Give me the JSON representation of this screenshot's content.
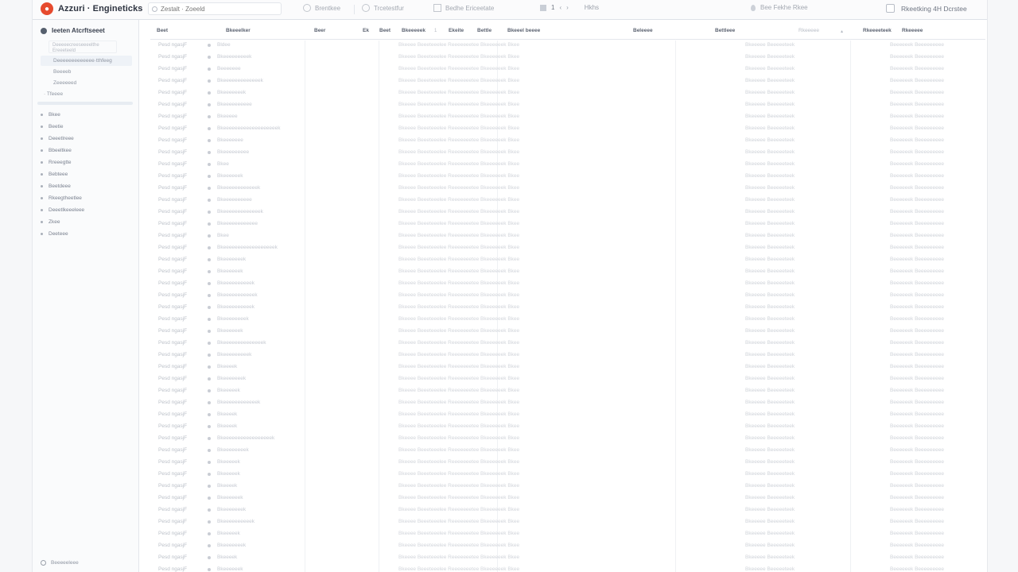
{
  "app": {
    "title": "Azzuri · Engineticks"
  },
  "toolbar": {
    "search_placeholder": "Zestalt · Zoeeld",
    "item1": "Brentkee",
    "item2": "Trcetestfur",
    "item3": "Bedhe Ericeetate",
    "pager_current": "1",
    "pager_prev": "‹",
    "pager_next": "›",
    "pager_label": "Hkhs",
    "location": "Bee Fekhe Rkee",
    "checkbox_label": "Rkeetking 4H Dcrstee",
    "checkbox_checked": false
  },
  "sidebar": {
    "header": "Ieeten Atcrftseeet",
    "card_text": "Deeeeecreeseeeelthe Ereeeteeld",
    "selected_item": "Deeeeeeeeeeeee·tthfeeg",
    "sub_items": [
      "Beeeeb",
      "Zeeeeeed"
    ],
    "dim_item": "Tfeeee",
    "items": [
      "Bkee",
      "Beetie",
      "Deeetlreee",
      "Bbeeltkee",
      "Rreeegtte",
      "Bebteee",
      "Beetdeee",
      "Rkeegtheetlee",
      "Deeetlkeeeleee",
      "Zkee",
      "Deeteee"
    ],
    "footer": "Beeeeeleee"
  },
  "table": {
    "columns": [
      "Beet",
      "Bkeeelker",
      "Beer",
      "Ek",
      "Beet",
      "Bkeeeeek",
      "1",
      "Ekeite",
      "Bettle",
      "Bkeeel beeee",
      "Beleeee",
      "Bettleee",
      "Rkeeeee",
      "▴",
      "Rkeeeeteek",
      "Rkeeeee"
    ],
    "rows": [
      {
        "name": "Pesd ngasjF",
        "cat": "Bldee",
        "long": "Bkeeee  Beeeteeelee  Reeeeeeetee  Bkeeeeeek  Bkee",
        "right": "Bkeeeee  Beeeeeteek",
        "end": "Beeeeeek  Beeeeeeeee"
      },
      {
        "name": "Pesd ngasjF",
        "cat": "Bkeeeeeeeeek",
        "long": "Bkeeee  Beeeteeelee  Reeeeeeetee  Bkeeeeeek  Bkee",
        "right": "Bkeeeee  Beeeeeteek",
        "end": "Beeeeeek  Beeeeeeeee"
      },
      {
        "name": "Pesd ngasjF",
        "cat": "Beeeeeee",
        "long": "Bkeeee  Beeeteeelee  Reeeeeeetee  Bkeeeeeek  Bkee",
        "right": "Bkeeeee  Beeeeeteek",
        "end": "Beeeeeek  Beeeeeeeee"
      },
      {
        "name": "Pesd ngasjF",
        "cat": "Bkeeeeeeeeeeeeek",
        "long": "Bkeeee  Beeeteeelee  Reeeeeeetee  Bkeeeeeek  Bkee",
        "right": "Bkeeeee  Beeeeeteek",
        "end": "Beeeeeek  Beeeeeeeee"
      },
      {
        "name": "Pesd ngasjF",
        "cat": "Bkeeeeeeek",
        "long": "Bkeeee  Beeeteeelee  Reeeeeeetee  Bkeeeeeek  Bkee",
        "right": "Bkeeeee  Beeeeeteek",
        "end": "Beeeeeek  Beeeeeeeee"
      },
      {
        "name": "Pesd ngasjF",
        "cat": "Bkeeeeeeeeee",
        "long": "Bkeeee  Beeeteeelee  Reeeeeeetee  Bkeeeeeek  Bkee",
        "right": "Bkeeeee  Beeeeeteek",
        "end": "Beeeeeek  Beeeeeeeee"
      },
      {
        "name": "Pesd ngasjF",
        "cat": "Bkeeeee",
        "long": "Bkeeee  Beeeteeelee  Reeeeeeetee  Bkeeeeeek  Bkee",
        "right": "Bkeeeee  Beeeeeteek",
        "end": "Beeeeeek  Beeeeeeeee"
      },
      {
        "name": "Pesd ngasjF",
        "cat": "Bkeeeeeeeeeeeeeeeeeeek",
        "long": "Bkeeee  Beeeteeelee  Reeeeeeetee  Bkeeeeeek  Bkee",
        "right": "Bkeeeee  Beeeeeteek",
        "end": "Beeeeeek  Beeeeeeeee"
      },
      {
        "name": "Pesd ngasjF",
        "cat": "Bkeeeeeee",
        "long": "Bkeeee  Beeeteeelee  Reeeeeeetee  Bkeeeeeek  Bkee",
        "right": "Bkeeeee  Beeeeeteek",
        "end": "Beeeeeek  Beeeeeeeee"
      },
      {
        "name": "Pesd ngasjF",
        "cat": "Bkeeeeeeeee",
        "long": "Bkeeee  Beeeteeelee  Reeeeeeetee  Bkeeeeeek  Bkee",
        "right": "Bkeeeee  Beeeeeteek",
        "end": "Beeeeeek  Beeeeeeeee"
      },
      {
        "name": "Pesd ngasjF",
        "cat": "Bkee",
        "long": "Bkeeee  Beeeteeelee  Reeeeeeetee  Bkeeeeeek  Bkee",
        "right": "Bkeeeee  Beeeeeteek",
        "end": "Beeeeeek  Beeeeeeeee"
      },
      {
        "name": "Pesd ngasjF",
        "cat": "Bkeeeeeek",
        "long": "Bkeeee  Beeeteeelee  Reeeeeeetee  Bkeeeeeek  Bkee",
        "right": "Bkeeeee  Beeeeeteek",
        "end": "Beeeeeek  Beeeeeeeee"
      },
      {
        "name": "Pesd ngasjF",
        "cat": "Bkeeeeeeeeeeeek",
        "long": "Bkeeee  Beeeteeelee  Reeeeeeetee  Bkeeeeeek  Bkee",
        "right": "Bkeeeee  Beeeeeteek",
        "end": "Beeeeeek  Beeeeeeeee"
      },
      {
        "name": "Pesd ngasjF",
        "cat": "Bkeeeeeeeeee",
        "long": "Bkeeee  Beeeteeelee  Reeeeeeetee  Bkeeeeeek  Bkee",
        "right": "Bkeeeee  Beeeeeteek",
        "end": "Beeeeeek  Beeeeeeeee"
      },
      {
        "name": "Pesd ngasjF",
        "cat": "Bkeeeeeeeeeeeeek",
        "long": "Bkeeee  Beeeteeelee  Reeeeeeetee  Bkeeeeeek  Bkee",
        "right": "Bkeeeee  Beeeeeteek",
        "end": "Beeeeeek  Beeeeeeeee"
      },
      {
        "name": "Pesd ngasjF",
        "cat": "Bkeeeeeeeeeeee",
        "long": "Bkeeee  Beeeteeelee  Reeeeeeetee  Bkeeeeeek  Bkee",
        "right": "Bkeeeee  Beeeeeteek",
        "end": "Beeeeeek  Beeeeeeeee"
      },
      {
        "name": "Pesd ngasjF",
        "cat": "Bkee",
        "long": "Bkeeee  Beeeteeelee  Reeeeeeetee  Bkeeeeeek  Bkee",
        "right": "Bkeeeee  Beeeeeteek",
        "end": "Beeeeeek  Beeeeeeeee"
      },
      {
        "name": "Pesd ngasjF",
        "cat": "Bkeeeeeeeeeeeeeeeeeek",
        "long": "Bkeeee  Beeeteeelee  Reeeeeeetee  Bkeeeeeek  Bkee",
        "right": "Bkeeeee  Beeeeeteek",
        "end": "Beeeeeek  Beeeeeeeee"
      },
      {
        "name": "Pesd ngasjF",
        "cat": "Bkeeeeeeek",
        "long": "Bkeeee  Beeeteeelee  Reeeeeeetee  Bkeeeeeek  Bkee",
        "right": "Bkeeeee  Beeeeeteek",
        "end": "Beeeeeek  Beeeeeeeee"
      },
      {
        "name": "Pesd ngasjF",
        "cat": "Bkeeeeeek",
        "long": "Bkeeee  Beeeteeelee  Reeeeeeetee  Bkeeeeeek  Bkee",
        "right": "Bkeeeee  Beeeeeteek",
        "end": "Beeeeeek  Beeeeeeeee"
      },
      {
        "name": "Pesd ngasjF",
        "cat": "Bkeeeeeeeeeek",
        "long": "Bkeeee  Beeeteeelee  Reeeeeeetee  Bkeeeeeek  Bkee",
        "right": "Bkeeeee  Beeeeeteek",
        "end": "Beeeeeek  Beeeeeeeee"
      },
      {
        "name": "Pesd ngasjF",
        "cat": "Bkeeeeeeeeeeek",
        "long": "Bkeeee  Beeeteeelee  Reeeeeeetee  Bkeeeeeek  Bkee",
        "right": "Bkeeeee  Beeeeeteek",
        "end": "Beeeeeek  Beeeeeeeee"
      },
      {
        "name": "Pesd ngasjF",
        "cat": "Bkeeeeeeeeeek",
        "long": "Bkeeee  Beeeteeelee  Reeeeeeetee  Bkeeeeeek  Bkee",
        "right": "Bkeeeee  Beeeeeteek",
        "end": "Beeeeeek  Beeeeeeeee"
      },
      {
        "name": "Pesd ngasjF",
        "cat": "Bkeeeeeeeek",
        "long": "Bkeeee  Beeeteeelee  Reeeeeeetee  Bkeeeeeek  Bkee",
        "right": "Bkeeeee  Beeeeeteek",
        "end": "Beeeeeek  Beeeeeeeee"
      },
      {
        "name": "Pesd ngasjF",
        "cat": "Bkeeeeeek",
        "long": "Bkeeee  Beeeteeelee  Reeeeeeetee  Bkeeeeeek  Bkee",
        "right": "Bkeeeee  Beeeeeteek",
        "end": "Beeeeeek  Beeeeeeeee"
      },
      {
        "name": "Pesd ngasjF",
        "cat": "Bkeeeeeeeeeeeeeek",
        "long": "Bkeeee  Beeeteeelee  Reeeeeeetee  Bkeeeeeek  Bkee",
        "right": "Bkeeeee  Beeeeeteek",
        "end": "Beeeeeek  Beeeeeeeee"
      },
      {
        "name": "Pesd ngasjF",
        "cat": "Bkeeeeeeeeek",
        "long": "Bkeeee  Beeeteeelee  Reeeeeeetee  Bkeeeeeek  Bkee",
        "right": "Bkeeeee  Beeeeeteek",
        "end": "Beeeeeek  Beeeeeeeee"
      },
      {
        "name": "Pesd ngasjF",
        "cat": "Bkeeeek",
        "long": "Bkeeee  Beeeteeelee  Reeeeeeetee  Bkeeeeeek  Bkee",
        "right": "Bkeeeee  Beeeeeteek",
        "end": "Beeeeeek  Beeeeeeeee"
      },
      {
        "name": "Pesd ngasjF",
        "cat": "Bkeeeeeeek",
        "long": "Bkeeee  Beeeteeelee  Reeeeeeetee  Bkeeeeeek  Bkee",
        "right": "Bkeeeee  Beeeeeteek",
        "end": "Beeeeeek  Beeeeeeeee"
      },
      {
        "name": "Pesd ngasjF",
        "cat": "Bkeeeeek",
        "long": "Bkeeee  Beeeteeelee  Reeeeeeetee  Bkeeeeeek  Bkee",
        "right": "Bkeeeee  Beeeeeteek",
        "end": "Beeeeeek  Beeeeeeeee"
      },
      {
        "name": "Pesd ngasjF",
        "cat": "Bkeeeeeeeeeeeek",
        "long": "Bkeeee  Beeeteeelee  Reeeeeeetee  Bkeeeeeek  Bkee",
        "right": "Bkeeeee  Beeeeeteek",
        "end": "Beeeeeek  Beeeeeeeee"
      },
      {
        "name": "Pesd ngasjF",
        "cat": "Bkeeeek",
        "long": "Bkeeee  Beeeteeelee  Reeeeeeetee  Bkeeeeeek  Bkee",
        "right": "Bkeeeee  Beeeeeteek",
        "end": "Beeeeeek  Beeeeeeeee"
      },
      {
        "name": "Pesd ngasjF",
        "cat": "Bkeeeek",
        "long": "Bkeeee  Beeeteeelee  Reeeeeeetee  Bkeeeeeek  Bkee",
        "right": "Bkeeeee  Beeeeeteek",
        "end": "Beeeeeek  Beeeeeeeee"
      },
      {
        "name": "Pesd ngasjF",
        "cat": "Bkeeeeeeeeeeeeeeeeek",
        "long": "Bkeeee  Beeeteeelee  Reeeeeeetee  Bkeeeeeek  Bkee",
        "right": "Bkeeeee  Beeeeeteek",
        "end": "Beeeeeek  Beeeeeeeee"
      },
      {
        "name": "Pesd ngasjF",
        "cat": "Bkeeeeeeeek",
        "long": "Bkeeee  Beeeteeelee  Reeeeeeetee  Bkeeeeeek  Bkee",
        "right": "Bkeeeee  Beeeeeteek",
        "end": "Beeeeeek  Beeeeeeeee"
      },
      {
        "name": "Pesd ngasjF",
        "cat": "Bkeeeeek",
        "long": "Bkeeee  Beeeteeelee  Reeeeeeetee  Bkeeeeeek  Bkee",
        "right": "Bkeeeee  Beeeeeteek",
        "end": "Beeeeeek  Beeeeeeeee"
      },
      {
        "name": "Pesd ngasjF",
        "cat": "Bkeeeeek",
        "long": "Bkeeee  Beeeteeelee  Reeeeeeetee  Bkeeeeeek  Bkee",
        "right": "Bkeeeee  Beeeeeteek",
        "end": "Beeeeeek  Beeeeeeeee"
      },
      {
        "name": "Pesd ngasjF",
        "cat": "Bkeeeek",
        "long": "Bkeeee  Beeeteeelee  Reeeeeeetee  Bkeeeeeek  Bkee",
        "right": "Bkeeeee  Beeeeeteek",
        "end": "Beeeeeek  Beeeeeeeee"
      },
      {
        "name": "Pesd ngasjF",
        "cat": "Bkeeeeeek",
        "long": "Bkeeee  Beeeteeelee  Reeeeeeetee  Bkeeeeeek  Bkee",
        "right": "Bkeeeee  Beeeeeteek",
        "end": "Beeeeeek  Beeeeeeeee"
      },
      {
        "name": "Pesd ngasjF",
        "cat": "Bkeeeeeeek",
        "long": "Bkeeee  Beeeteeelee  Reeeeeeetee  Bkeeeeeek  Bkee",
        "right": "Bkeeeee  Beeeeeteek",
        "end": "Beeeeeek  Beeeeeeeee"
      },
      {
        "name": "Pesd ngasjF",
        "cat": "Bkeeeeeeeeeek",
        "long": "Bkeeee  Beeeteeelee  Reeeeeeetee  Bkeeeeeek  Bkee",
        "right": "Bkeeeee  Beeeeeteek",
        "end": "Beeeeeek  Beeeeeeeee"
      },
      {
        "name": "Pesd ngasjF",
        "cat": "Bkeeeeek",
        "long": "Bkeeee  Beeeteeelee  Reeeeeeetee  Bkeeeeeek  Bkee",
        "right": "Bkeeeee  Beeeeeteek",
        "end": "Beeeeeek  Beeeeeeeee"
      },
      {
        "name": "Pesd ngasjF",
        "cat": "Bkeeeeeeek",
        "long": "Bkeeee  Beeeteeelee  Reeeeeeetee  Bkeeeeeek  Bkee",
        "right": "Bkeeeee  Beeeeeteek",
        "end": "Beeeeeek  Beeeeeeeee"
      },
      {
        "name": "Pesd ngasjF",
        "cat": "Bkeeeek",
        "long": "Bkeeee  Beeeteeelee  Reeeeeeetee  Bkeeeeeek  Bkee",
        "right": "Bkeeeee  Beeeeeteek",
        "end": "Beeeeeek  Beeeeeeeee"
      },
      {
        "name": "Pesd ngasjF",
        "cat": "Bkeeeeeek",
        "long": "Bkeeee  Beeeteeelee  Reeeeeeetee  Bkeeeeeek  Bkee",
        "right": "Bkeeeee  Beeeeeteek",
        "end": "Beeeeeek  Beeeeeeeee"
      }
    ]
  },
  "colors": {
    "accent": "#e64a2e"
  }
}
